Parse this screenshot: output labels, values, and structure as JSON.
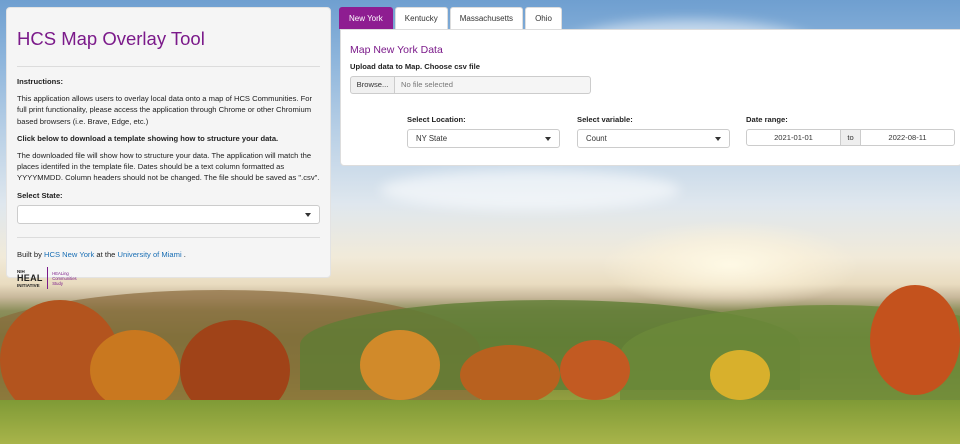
{
  "sidebar": {
    "title": "HCS Map Overlay Tool",
    "instructions_heading": "Instructions:",
    "instructions_text": "This application allows users to overlay local data onto a map of HCS Communities. For full print functionality, please access the application through Chrome or other Chromium based browsers (i.e. Brave, Edge, etc.)",
    "download_heading": "Click below to download a template showing how to structure your data.",
    "download_text": "The downloaded file will show how to structure your data. The application will match the places identifed in the template file. Dates should be a text column formatted as YYYYMMDD. Column headers should not be changed. The file should be saved as \".csv\".",
    "select_state_label": "Select State:",
    "select_state_value": "",
    "built_by_prefix": "Built by",
    "built_by_link": "HCS New York",
    "built_by_mid": "at the",
    "university_link": "University of Miami",
    "built_by_suffix": ".",
    "logo": {
      "nih": "NIH",
      "heal": "HEAL",
      "initiative": "INITIATIVE",
      "right_line1": "HEALing",
      "right_line2": "Communities",
      "right_line3": "Study"
    }
  },
  "tabs": [
    {
      "label": "New York",
      "active": true
    },
    {
      "label": "Kentucky",
      "active": false
    },
    {
      "label": "Massachusetts",
      "active": false
    },
    {
      "label": "Ohio",
      "active": false
    }
  ],
  "panel": {
    "title": "Map New York Data",
    "upload_label": "Upload data to Map. Choose csv file",
    "browse_label": "Browse...",
    "file_placeholder": "No file selected",
    "location_label": "Select Location:",
    "location_value": "NY State",
    "variable_label": "Select variable:",
    "variable_value": "Count",
    "date_label": "Date range:",
    "date_start": "2021-01-01",
    "date_sep": "to",
    "date_end": "2022-08-11"
  },
  "colors": {
    "accent": "#8e1d91",
    "title": "#7b1a8a",
    "link": "#1a6fb5"
  }
}
